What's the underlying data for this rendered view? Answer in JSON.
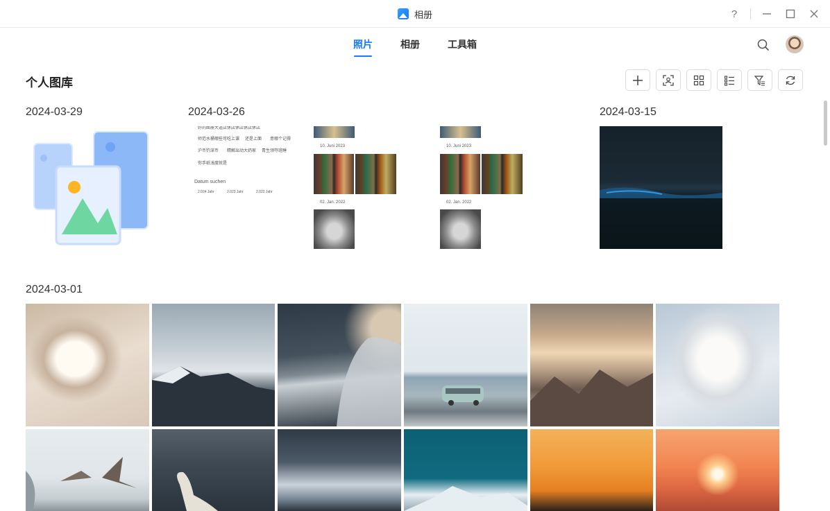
{
  "window": {
    "title": "相册",
    "help": "?",
    "minimize": "—",
    "maximize": "☐",
    "close": "✕"
  },
  "nav": {
    "tabs": [
      {
        "label": "照片",
        "active": true
      },
      {
        "label": "相册",
        "active": false
      },
      {
        "label": "工具箱",
        "active": false
      }
    ]
  },
  "page": {
    "title": "个人图库"
  },
  "toolbar": {
    "buttons": [
      "add-icon",
      "face-scan-icon",
      "grid-view-icon",
      "list-view-icon",
      "filter-icon",
      "refresh-icon"
    ]
  },
  "groups": [
    {
      "date": "2024-03-29"
    },
    {
      "date": "2024-03-26"
    },
    {
      "date": "2024-03-15"
    },
    {
      "date": "2024-03-01"
    }
  ],
  "screenshot_doc": {
    "lines": [
      "好的图册大道店休店休店休店休店",
      "师范水桶哪些可吃上课",
      "还是上面",
      "意哪个记得",
      "沪币钓深币",
      "精解出动大奶家",
      "青生领夺班睡",
      "你手纸浅度就是"
    ],
    "search_label": "Datum suchen",
    "years": [
      "2.024 Jahr",
      "2.023 Jahr",
      "2.022 Jahr"
    ]
  },
  "screenshot_dates": {
    "d1": "10. Juni 2023",
    "d2": "02. Jan. 2022"
  },
  "colors": {
    "accent": "#1677ff"
  }
}
